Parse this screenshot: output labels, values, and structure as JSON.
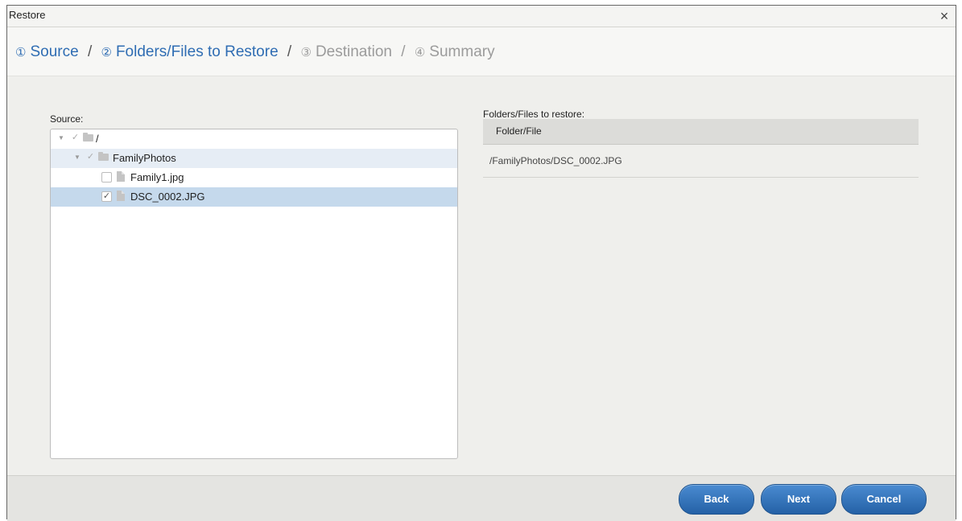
{
  "window": {
    "title": "Restore",
    "close_glyph": "×"
  },
  "steps": [
    {
      "num": "①",
      "label": "Source",
      "state": "done"
    },
    {
      "num": "②",
      "label": "Folders/Files to Restore",
      "state": "current"
    },
    {
      "num": "③",
      "label": "Destination",
      "state": "pending"
    },
    {
      "num": "④",
      "label": "Summary",
      "state": "pending"
    }
  ],
  "step_separator": "/",
  "source": {
    "label": "Source:",
    "tree": [
      {
        "name": "/",
        "type": "folder",
        "checked": "partial",
        "expanded": true
      },
      {
        "name": "FamilyPhotos",
        "type": "folder",
        "checked": "partial",
        "expanded": true
      },
      {
        "name": "Family1.jpg",
        "type": "file",
        "checked": false
      },
      {
        "name": "DSC_0002.JPG",
        "type": "file",
        "checked": true
      }
    ]
  },
  "restore_list": {
    "label": "Folders/Files to restore:",
    "column_header": "Folder/File",
    "rows": [
      "/FamilyPhotos/DSC_0002.JPG"
    ]
  },
  "buttons": {
    "back": "Back",
    "next": "Next",
    "cancel": "Cancel"
  },
  "colors": {
    "accent": "#2f6db3",
    "button": "#2e6fb6",
    "selected_row": "#c5d9ec"
  }
}
